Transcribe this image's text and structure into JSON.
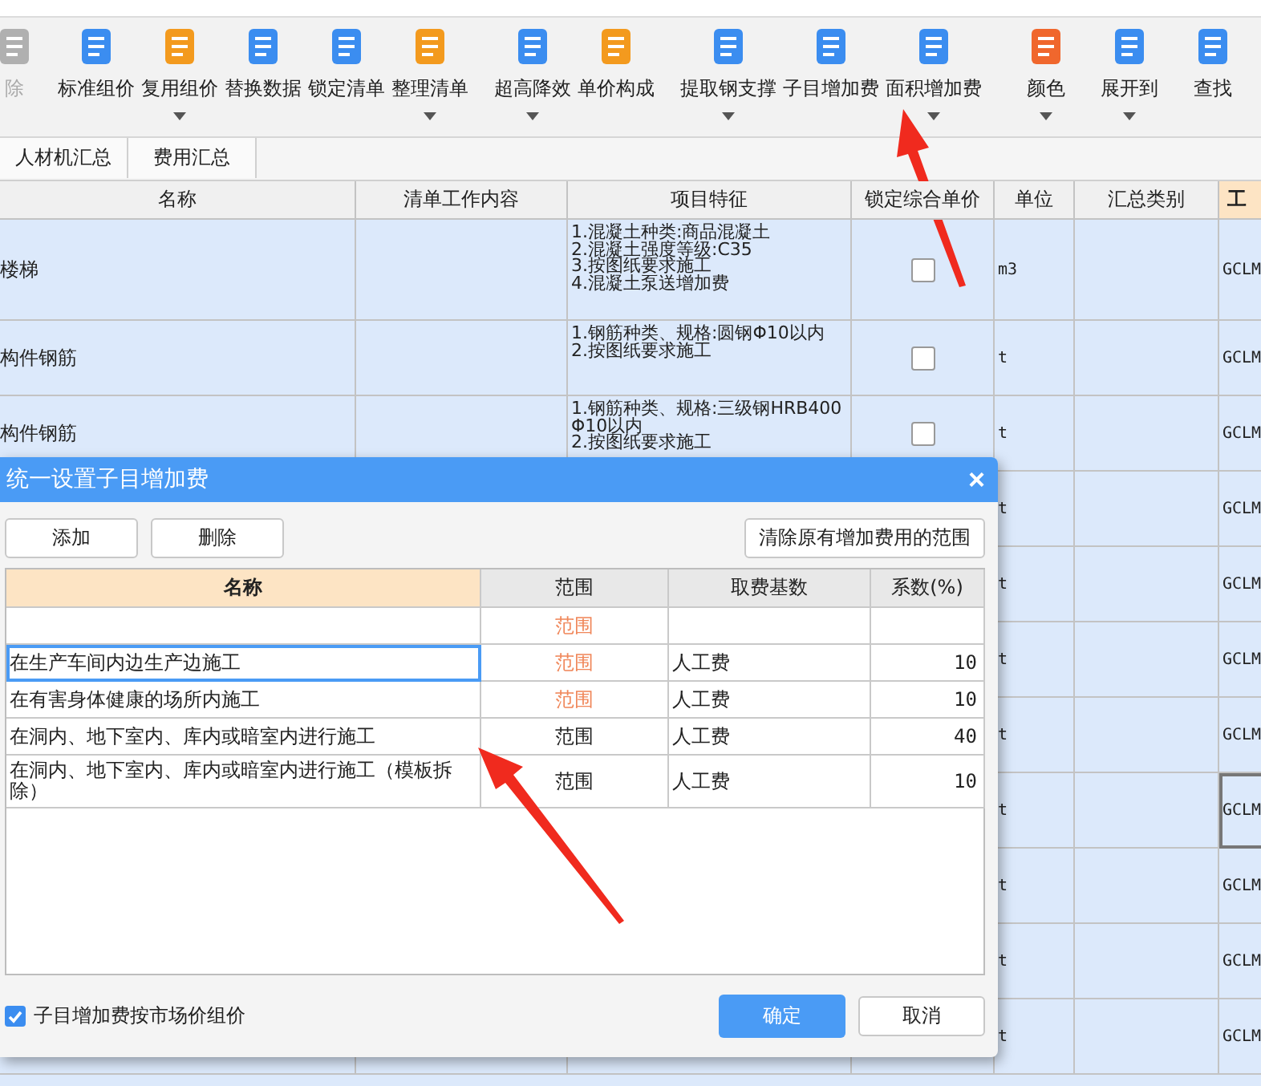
{
  "toolbar": [
    {
      "label": "除",
      "disabled": true,
      "dropdown": false
    },
    {
      "label": "标准组价",
      "disabled": false,
      "dropdown": false
    },
    {
      "label": "复用组价",
      "disabled": false,
      "dropdown": true
    },
    {
      "label": "替换数据",
      "disabled": false,
      "dropdown": false
    },
    {
      "label": "锁定清单",
      "disabled": false,
      "dropdown": false
    },
    {
      "label": "整理清单",
      "disabled": false,
      "dropdown": true
    },
    {
      "label": "超高降效",
      "disabled": false,
      "dropdown": true
    },
    {
      "label": "单价构成",
      "disabled": false,
      "dropdown": false
    },
    {
      "label": "提取钢支撑",
      "disabled": false,
      "dropdown": true
    },
    {
      "label": "子目增加费",
      "disabled": false,
      "dropdown": false
    },
    {
      "label": "面积增加费",
      "disabled": false,
      "dropdown": true
    },
    {
      "label": "颜色",
      "disabled": false,
      "dropdown": true
    },
    {
      "label": "展开到",
      "disabled": false,
      "dropdown": true
    },
    {
      "label": "查找",
      "disabled": false,
      "dropdown": false
    }
  ],
  "tabs": [
    "人材机汇总",
    "费用汇总"
  ],
  "grid": {
    "columns": [
      "名称",
      "清单工作内容",
      "项目特征",
      "锁定综合单价",
      "单位",
      "汇总类别",
      "工"
    ],
    "rows": [
      {
        "name": "楼梯",
        "features": [
          "1.混凝土种类:商品混凝土",
          "2.混凝土强度等级:C35",
          "3.按图纸要求施工",
          "4.混凝土泵送增加费"
        ],
        "locked": false,
        "unit": "m3",
        "code": "GCLM",
        "selected": false
      },
      {
        "name": "构件钢筋",
        "features": [
          "1.钢筋种类、规格:圆钢Φ10以内",
          "2.按图纸要求施工"
        ],
        "locked": false,
        "unit": "t",
        "code": "GCLM",
        "selected": false
      },
      {
        "name": "构件钢筋",
        "features": [
          "1.钢筋种类、规格:三级钢HRB400Φ10以内",
          "2.按图纸要求施工"
        ],
        "locked": false,
        "unit": "t",
        "code": "GCLM",
        "selected": false
      },
      {
        "unit": "t",
        "code": "GCLM",
        "selected": false
      },
      {
        "unit": "t",
        "code": "GCLM",
        "selected": false
      },
      {
        "unit": "t",
        "code": "GCLM",
        "selected": false
      },
      {
        "unit": "t",
        "code": "GCLM",
        "selected": false
      },
      {
        "unit": "t",
        "code": "GCLM",
        "selected": true
      },
      {
        "unit": "t",
        "code": "GCLM",
        "selected": false
      },
      {
        "unit": "t",
        "code": "GCLM",
        "selected": false
      },
      {
        "unit": "t",
        "code": "GCLM",
        "selected": false
      }
    ]
  },
  "dialog": {
    "title": "统一设置子目增加费",
    "close": "×",
    "buttons": [
      "添加",
      "删除"
    ],
    "clear_button": "清除原有增加费用的范围",
    "columns": [
      "名称",
      "范围",
      "取费基数",
      "系数(%)"
    ],
    "rows": [
      {
        "name": "",
        "scope": "范围",
        "scope_highlighted": true,
        "base": "",
        "rate": "",
        "selected": false
      },
      {
        "name": "在生产车间内边生产边施工",
        "scope": "范围",
        "scope_highlighted": true,
        "base": "人工费",
        "rate": "10",
        "selected": true
      },
      {
        "name": "在有害身体健康的场所内施工",
        "scope": "范围",
        "scope_highlighted": true,
        "base": "人工费",
        "rate": "10",
        "selected": false
      },
      {
        "name": "在洞内、地下室内、库内或暗室内进行施工",
        "scope": "范围",
        "scope_highlighted": false,
        "base": "人工费",
        "rate": "40",
        "selected": false
      },
      {
        "name": "在洞内、地下室内、库内或暗室内进行施工（模板拆除）",
        "scope": "范围",
        "scope_highlighted": false,
        "base": "人工费",
        "rate": "10",
        "selected": false
      }
    ],
    "market_price": {
      "label": "子目增加费按市场价组价",
      "checked": true
    },
    "ok": "确定",
    "cancel": "取消"
  }
}
